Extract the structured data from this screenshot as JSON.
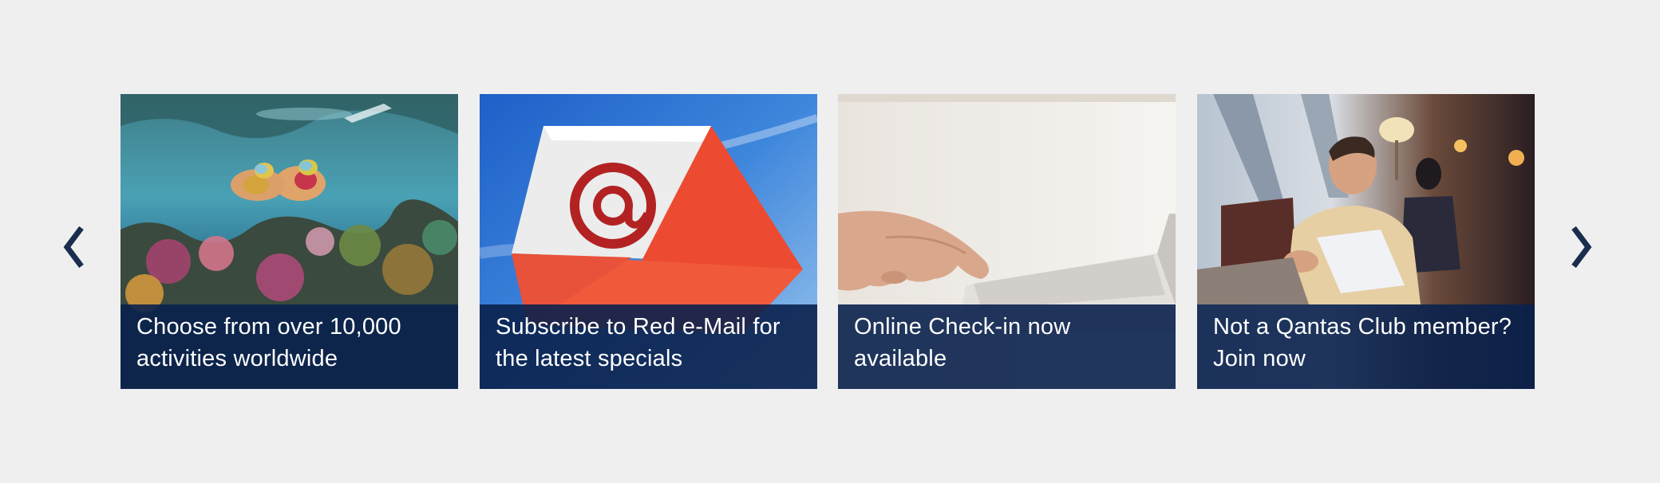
{
  "carousel": {
    "prev_icon": "chevron-left-icon",
    "next_icon": "chevron-right-icon",
    "arrow_color": "#1a2d4f",
    "caption_bg": "#0a214d",
    "cards": [
      {
        "caption": "Choose from over 10,000 activities worldwide",
        "image": "snorkelers-coral-reef"
      },
      {
        "caption": "Subscribe to Red e-Mail for the latest specials",
        "image": "red-envelope-at-sign"
      },
      {
        "caption": "Online Check-in now available",
        "image": "hand-on-laptop"
      },
      {
        "caption": "Not a Qantas Club member? Join now",
        "image": "man-reading-in-lounge"
      }
    ]
  }
}
